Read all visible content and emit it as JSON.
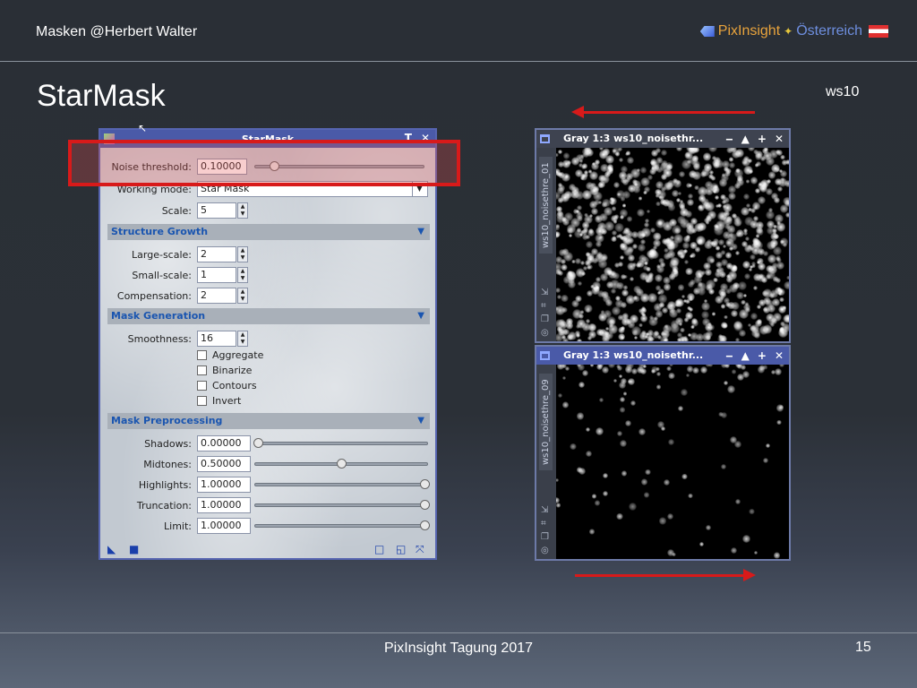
{
  "slide": {
    "header_left": "Masken  @Herbert Walter",
    "brand": "PixInsight",
    "country": "Österreich",
    "title": "StarMask",
    "side_tag": "ws10",
    "footer": "PixInsight Tagung 2017",
    "page_number": "15"
  },
  "dialog": {
    "title": "StarMask",
    "controls": [
      "T",
      "✕"
    ],
    "noise_threshold": {
      "label": "Noise threshold:",
      "value": "0.10000",
      "slider": 0.1
    },
    "working_mode": {
      "label": "Working mode:",
      "value": "Star Mask"
    },
    "scale": {
      "label": "Scale:",
      "value": "5"
    },
    "structure_growth": {
      "title": "Structure Growth",
      "large_scale": {
        "label": "Large-scale:",
        "value": "2"
      },
      "small_scale": {
        "label": "Small-scale:",
        "value": "1"
      },
      "compensation": {
        "label": "Compensation:",
        "value": "2"
      }
    },
    "mask_generation": {
      "title": "Mask Generation",
      "smoothness": {
        "label": "Smoothness:",
        "value": "16"
      },
      "aggregate": "Aggregate",
      "binarize": "Binarize",
      "contours": "Contours",
      "invert": "Invert"
    },
    "mask_preprocessing": {
      "title": "Mask Preprocessing",
      "shadows": {
        "label": "Shadows:",
        "value": "0.00000",
        "slider": 0.0
      },
      "midtones": {
        "label": "Midtones:",
        "value": "0.50000",
        "slider": 0.5
      },
      "highlights": {
        "label": "Highlights:",
        "value": "1.00000",
        "slider": 1.0
      },
      "truncation": {
        "label": "Truncation:",
        "value": "1.00000",
        "slider": 1.0
      },
      "limit": {
        "label": "Limit:",
        "value": "1.00000",
        "slider": 1.0
      }
    }
  },
  "windows": [
    {
      "title": "Gray 1:3 ws10_noisethr...",
      "side_label": "ws10_noisethre_01"
    },
    {
      "title": "Gray 1:3 ws10_noisethr...",
      "side_label": "ws10_noisethre_09"
    }
  ],
  "window_controls": [
    "‒",
    "▲",
    "+",
    "✕"
  ],
  "colors": {
    "accent_red": "#d81a1a",
    "dialog_title": "#4a5aa8",
    "section_text": "#1a55b0"
  }
}
